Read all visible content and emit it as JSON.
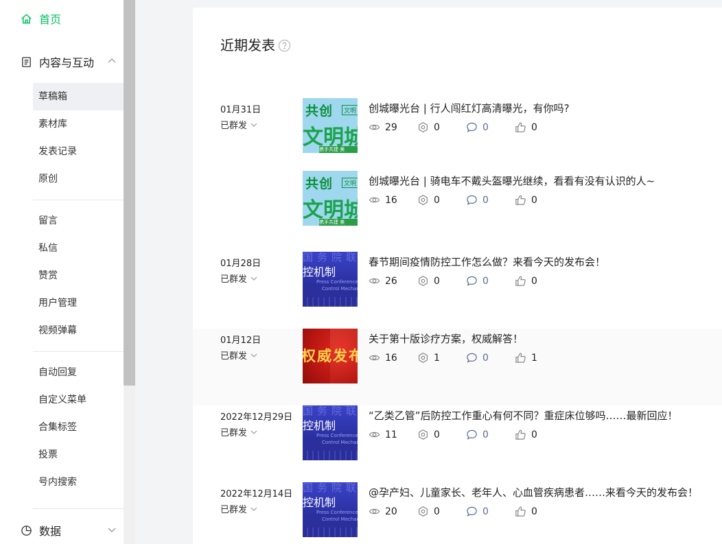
{
  "sidebar": {
    "home": "首页",
    "groups": {
      "content": "内容与互动",
      "data": "数据"
    },
    "items": {
      "drafts": "草稿箱",
      "materials": "素材库",
      "publish_records": "发表记录",
      "original": "原创",
      "comments": "留言",
      "messages": "私信",
      "rewards": "赞赏",
      "user_manage": "用户管理",
      "video_danmu": "视频弹幕",
      "auto_reply": "自动回复",
      "custom_menu": "自定义菜单",
      "collection_tags": "合集标签",
      "vote": "投票",
      "in_account_search": "号内搜索"
    }
  },
  "main": {
    "title": "近期发表",
    "posts": [
      {
        "date": "01月31日",
        "status": "已群发",
        "title": "创城曝光台 | 行人闯红灯高清曝光，有你吗?",
        "views": "29",
        "shares": "0",
        "comments": "0",
        "likes": "0",
        "thumb": {
          "l1": "共创",
          "l1s": "文明",
          "l2": "文明城",
          "l3": "携手共建 美"
        }
      },
      {
        "date": "",
        "status": "",
        "title": "创城曝光台 | 骑电车不戴头盔曝光继续，看看有没有认识的人~",
        "views": "16",
        "shares": "0",
        "comments": "0",
        "likes": "0",
        "thumb": {
          "l1": "共创",
          "l1s": "文明",
          "l2": "文明城",
          "l3": "携手共建 美"
        }
      },
      {
        "date": "01月28日",
        "status": "已群发",
        "title": "春节期间疫情防控工作怎么做？来看今天的发布会！",
        "views": "26",
        "shares": "0",
        "comments": "0",
        "likes": "0",
        "thumb": {
          "b0": "国务院联",
          "b1": "控机制",
          "b2": "Press Conference o",
          "b3": "Control Mechanis"
        }
      },
      {
        "date": "01月12日",
        "status": "已群发",
        "title": "关于第十版诊疗方案，权威解答！",
        "views": "16",
        "shares": "1",
        "comments": "0",
        "likes": "1",
        "thumb": {
          "r1": "权威发布"
        }
      },
      {
        "date": "2022年12月29日",
        "status": "已群发",
        "title": "“乙类乙管”后防控工作重心有何不同？重症床位够吗……最新回应！",
        "views": "11",
        "shares": "0",
        "comments": "0",
        "likes": "0",
        "thumb": {
          "b0": "国务院联",
          "b1": "控机制",
          "b2": "Press Conference o",
          "b3": "Control Mechanis"
        }
      },
      {
        "date": "2022年12月14日",
        "status": "已群发",
        "title": "@孕产妇、儿童家长、老年人、心血管疾病患者……来看今天的发布会！",
        "views": "20",
        "shares": "0",
        "comments": "0",
        "likes": "0",
        "thumb": {
          "b0": "国务院联",
          "b1": "控机制",
          "b2": "Press Conference o",
          "b3": "Control Mechanis"
        }
      }
    ]
  },
  "colors": {
    "accent": "#07c160",
    "link": "#576b95"
  }
}
